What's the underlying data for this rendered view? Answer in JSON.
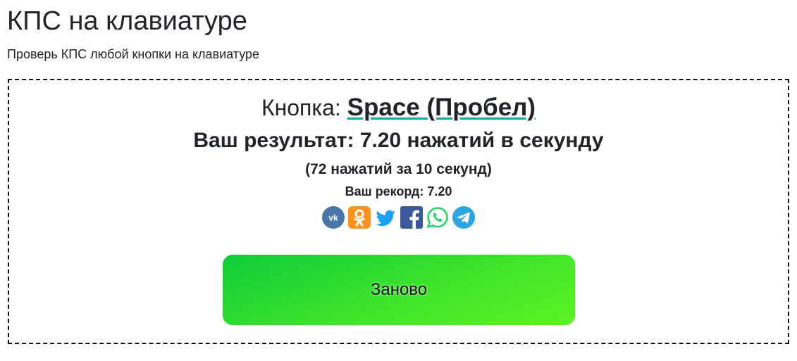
{
  "page": {
    "title": "КПС на клавиатуре",
    "subtitle": "Проверь КПС любой кнопки на клавиатуре"
  },
  "test": {
    "key_label": "Кнопка:",
    "key_name": "Space (Пробел)",
    "result_text": "Ваш результат: 7.20 нажатий в секунду",
    "detail_text": "(72 нажатий за 10 секунд)",
    "record_label": "Ваш рекорд:",
    "record_value": "7.20"
  },
  "share": [
    {
      "name": "vk-icon",
      "color": "#4a76a8"
    },
    {
      "name": "odnoklassniki-icon",
      "color": "#f7931e"
    },
    {
      "name": "twitter-icon",
      "color": "#1da1f2"
    },
    {
      "name": "facebook-icon",
      "color": "#3b5998"
    },
    {
      "name": "whatsapp-icon",
      "color": "#25d366"
    },
    {
      "name": "telegram-icon",
      "color": "#2ca5e0"
    }
  ],
  "restart_button": {
    "label": "Заново"
  },
  "colors": {
    "accent_underline": "#1aa694",
    "button_gradient_start": "#0fcb3a",
    "button_gradient_end": "#5cf325"
  }
}
